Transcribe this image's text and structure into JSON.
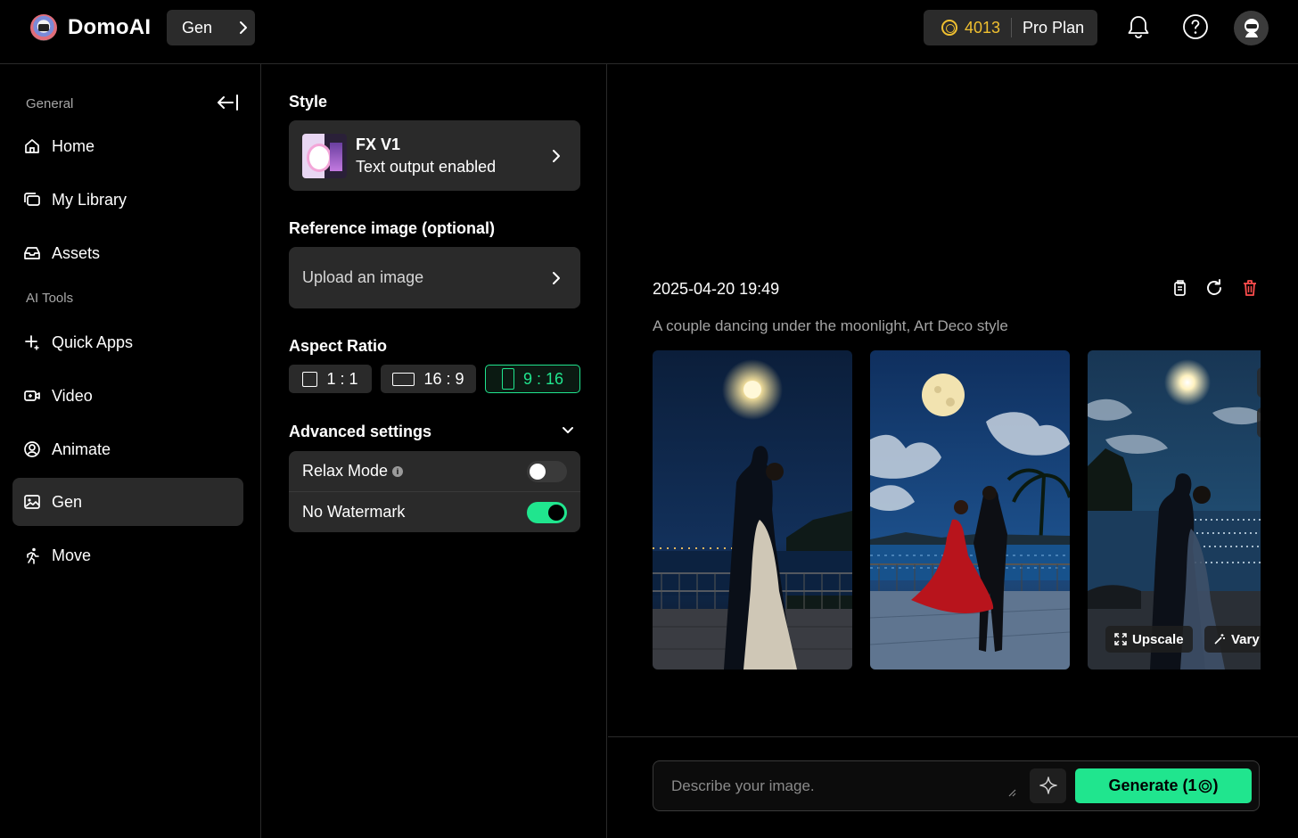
{
  "app": {
    "name": "DomoAI",
    "section_pill": "Gen"
  },
  "topbar": {
    "credits": "4013",
    "plan": "Pro Plan"
  },
  "sidebar": {
    "general_label": "General",
    "ai_tools_label": "AI Tools",
    "items": [
      {
        "label": "Home",
        "icon": "home-icon"
      },
      {
        "label": "My Library",
        "icon": "library-icon"
      },
      {
        "label": "Assets",
        "icon": "assets-icon"
      },
      {
        "label": "Quick Apps",
        "icon": "sparkle-icon"
      },
      {
        "label": "Video",
        "icon": "video-icon"
      },
      {
        "label": "Animate",
        "icon": "animate-icon"
      },
      {
        "label": "Gen",
        "icon": "image-icon",
        "active": true
      },
      {
        "label": "Move",
        "icon": "move-icon"
      }
    ]
  },
  "settings": {
    "style_heading": "Style",
    "style_name": "FX V1",
    "style_sub": "Text output enabled",
    "reference_heading": "Reference image (optional)",
    "upload_label": "Upload an image",
    "aspect_heading": "Aspect Ratio",
    "ratios": [
      {
        "label": "1 : 1",
        "selected": false
      },
      {
        "label": "16 : 9",
        "selected": false
      },
      {
        "label": "9 : 16",
        "selected": true
      }
    ],
    "advanced_heading": "Advanced settings",
    "relax_label": "Relax Mode",
    "relax_on": false,
    "watermark_label": "No Watermark",
    "watermark_on": true
  },
  "result": {
    "timestamp": "2025-04-20 19:49",
    "prompt": "A couple dancing under the moonlight, Art Deco style",
    "upscale_label": "Upscale",
    "vary_label": "Vary"
  },
  "composer": {
    "placeholder": "Describe your image.",
    "generate_label": "Generate (1",
    "generate_suffix": ")"
  },
  "colors": {
    "accent": "#20e58e",
    "coin": "#f0c030",
    "delete": "#ff4d4d"
  }
}
